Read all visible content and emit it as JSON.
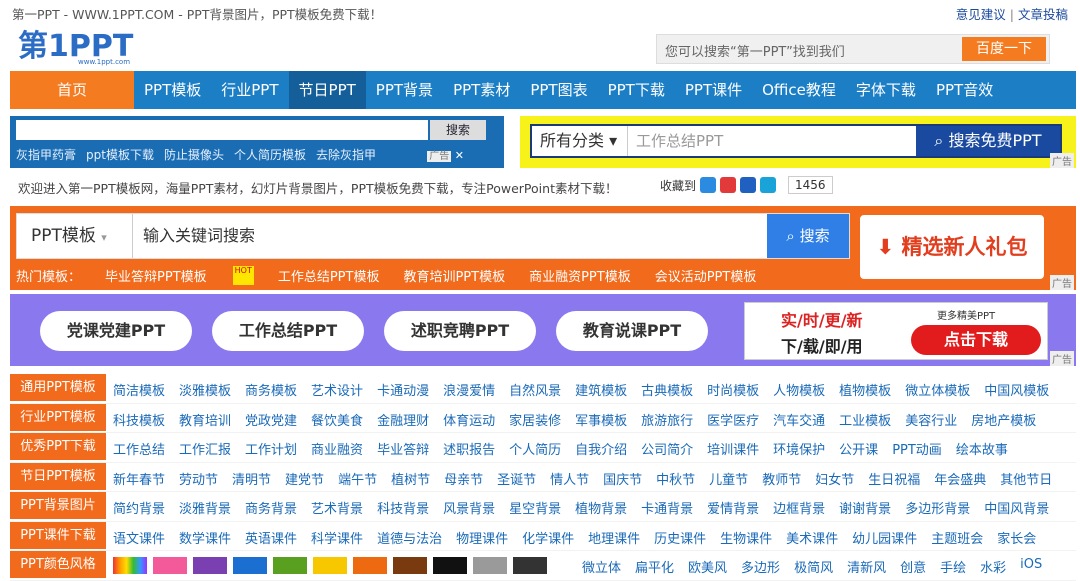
{
  "topbar": {
    "title": "第一PPT - WWW.1PPT.COM - PPT背景图片，PPT模板免费下载！",
    "links": [
      "意见建议",
      "文章投稿"
    ],
    "sep": "|"
  },
  "logo": {
    "text": "第1PPT",
    "sub": "www.1ppt.com"
  },
  "search": {
    "placeholder": "您可以搜索“第一PPT”找到我们",
    "button": "百度一下"
  },
  "nav": {
    "home": "首页",
    "items": [
      "PPT模板",
      "行业PPT",
      "节日PPT",
      "PPT背景",
      "PPT素材",
      "PPT图表",
      "PPT下载",
      "PPT课件",
      "Office教程",
      "字体下载",
      "PPT音效"
    ]
  },
  "ad_left": {
    "button": "搜索",
    "links": [
      "灰指甲药膏",
      "ppt模板下载",
      "防止摄像头",
      "个人简历模板",
      "去除灰指甲"
    ],
    "ad_label": "广告"
  },
  "ad_right": {
    "category": "所有分类",
    "keyword": "工作总结PPT",
    "button": "搜索免费PPT",
    "ad_label": "广告"
  },
  "welcome": "欢迎进入第一PPT模板网，海量PPT素材，幻灯片背景图片，PPT模板免费下载，专注PowerPoint素材下载！",
  "fav": {
    "label": "收藏到",
    "count": "1456",
    "colors": [
      "#2a8be0",
      "#e23a3a",
      "#2060c0",
      "#1aa3d8"
    ]
  },
  "main_search": {
    "category": "PPT模板",
    "placeholder": "输入关键词搜索",
    "button": "搜索"
  },
  "gift": "精选新人礼包",
  "hot": {
    "prefix": "热门模板：",
    "items": [
      "毕业答辩PPT模板",
      "工作总结PPT模板",
      "教育培训PPT模板",
      "商业融资PPT模板",
      "会议活动PPT模板"
    ],
    "badge": "HOT"
  },
  "pills": [
    "党课党建PPT",
    "工作总结PPT",
    "述职竞聘PPT",
    "教育说课PPT"
  ],
  "realad": {
    "l1": "实/时/更/新",
    "l2": "下/载/即/用",
    "more": "更多精美PPT",
    "btn": "点击下载"
  },
  "ad_tag": "广告",
  "categories": [
    {
      "label": "通用PPT模板",
      "links": [
        "简洁模板",
        "淡雅模板",
        "商务模板",
        "艺术设计",
        "卡通动漫",
        "浪漫爱情",
        "自然风景",
        "建筑模板",
        "古典模板",
        "时尚模板",
        "人物模板",
        "植物模板",
        "微立体模板",
        "中国风模板"
      ]
    },
    {
      "label": "行业PPT模板",
      "links": [
        "科技模板",
        "教育培训",
        "党政党建",
        "餐饮美食",
        "金融理财",
        "体育运动",
        "家居装修",
        "军事模板",
        "旅游旅行",
        "医学医疗",
        "汽车交通",
        "工业模板",
        "美容行业",
        "房地产模板"
      ]
    },
    {
      "label": "优秀PPT下载",
      "links": [
        "工作总结",
        "工作汇报",
        "工作计划",
        "商业融资",
        "毕业答辩",
        "述职报告",
        "个人简历",
        "自我介绍",
        "公司简介",
        "培训课件",
        "环境保护",
        "公开课",
        "PPT动画",
        "绘本故事"
      ]
    },
    {
      "label": "节日PPT模板",
      "links": [
        "新年春节",
        "劳动节",
        "清明节",
        "建党节",
        "端午节",
        "植树节",
        "母亲节",
        "圣诞节",
        "情人节",
        "国庆节",
        "中秋节",
        "儿童节",
        "教师节",
        "妇女节",
        "生日祝福",
        "年会盛典",
        "其他节日"
      ]
    },
    {
      "label": "PPT背景图片",
      "links": [
        "简约背景",
        "淡雅背景",
        "商务背景",
        "艺术背景",
        "科技背景",
        "风景背景",
        "星空背景",
        "植物背景",
        "卡通背景",
        "爱情背景",
        "边框背景",
        "谢谢背景",
        "多边形背景",
        "中国风背景"
      ]
    },
    {
      "label": "PPT课件下载",
      "links": [
        "语文课件",
        "数学课件",
        "英语课件",
        "科学课件",
        "道德与法治",
        "物理课件",
        "化学课件",
        "地理课件",
        "历史课件",
        "生物课件",
        "美术课件",
        "幼儿园课件",
        "主题班会",
        "家长会"
      ]
    },
    {
      "label": "PPT颜色风格",
      "links": [
        "微立体",
        "扁平化",
        "欧美风",
        "多边形",
        "极简风",
        "清新风",
        "创意",
        "手绘",
        "水彩",
        "iOS"
      ]
    }
  ],
  "swatches": [
    "#d81e1e",
    "#f25a9a",
    "#7a3fb0",
    "#1a6fd0",
    "#5aa020",
    "#f7c800",
    "#ee6a10",
    "#7a3a10",
    "#111111",
    "#9a9a9a",
    "#333333"
  ]
}
